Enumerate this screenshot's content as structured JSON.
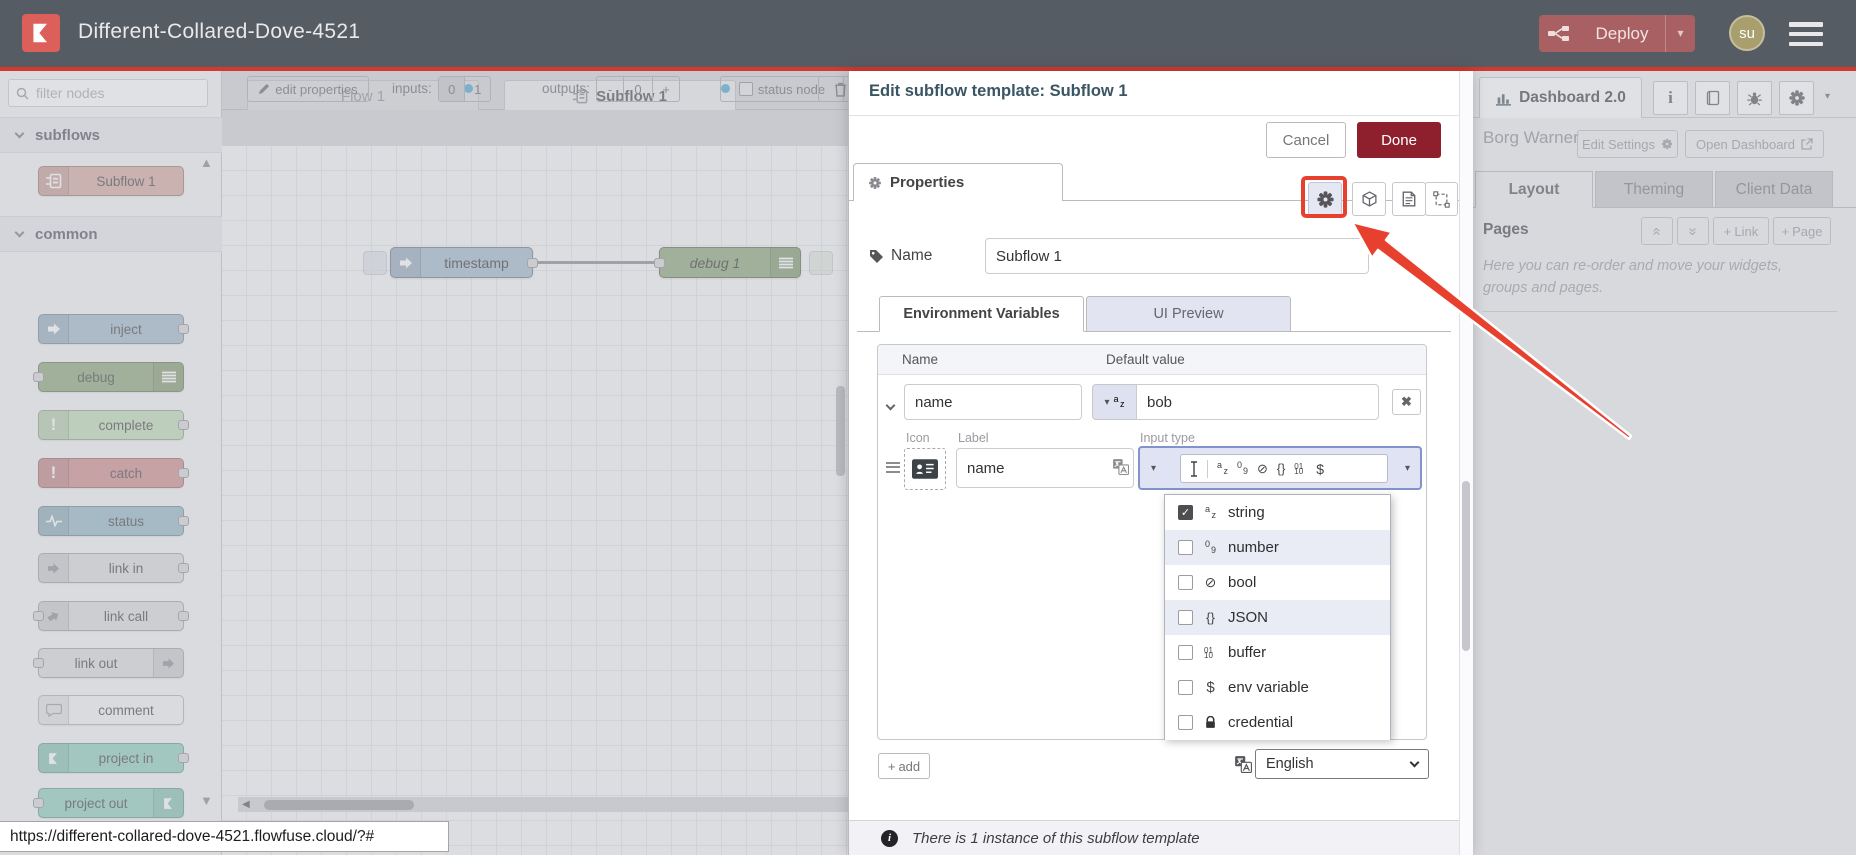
{
  "colors": {
    "header_bg": "#565c63",
    "brand_red": "#d3392e",
    "logo_red": "#dd5f5a",
    "deploy_red": "#a86063",
    "done_red": "#8e1f2d",
    "annotation_red": "#e8402f",
    "lavender": "#dfe3f3",
    "teal": "#8ed0c0",
    "modified_dot_blue": "#49a8d8"
  },
  "header": {
    "title": "Different-Collared-Dove-4521",
    "deploy_label": "Deploy",
    "avatar_initials": "su"
  },
  "palette": {
    "filter_placeholder": "filter nodes",
    "categories": [
      {
        "label": "subflows",
        "nodes": [
          {
            "label": "Subflow 1"
          }
        ]
      },
      {
        "label": "common",
        "nodes": [
          {
            "label": "inject"
          },
          {
            "label": "debug"
          },
          {
            "label": "complete"
          },
          {
            "label": "catch"
          },
          {
            "label": "status"
          },
          {
            "label": "link in"
          },
          {
            "label": "link call"
          },
          {
            "label": "link out"
          },
          {
            "label": "comment"
          },
          {
            "label": "project in"
          },
          {
            "label": "project out"
          }
        ]
      }
    ]
  },
  "workspace": {
    "tabs": [
      {
        "label": "Flow 1"
      },
      {
        "label": "Subflow 1"
      }
    ],
    "toolbar": {
      "edit_properties": "edit properties",
      "inputs_label": "inputs:",
      "input_options": [
        "0",
        "1"
      ],
      "outputs_label": "outputs:",
      "outputs_minus": "-",
      "outputs_value": "0",
      "outputs_plus": "+",
      "status_node_label": "status node"
    },
    "nodes": [
      {
        "label": "timestamp"
      },
      {
        "label": "debug 1"
      }
    ]
  },
  "dialog": {
    "title": "Edit subflow template: Subflow 1",
    "cancel_label": "Cancel",
    "done_label": "Done",
    "properties_tab": "Properties",
    "name_label": "Name",
    "name_value": "Subflow 1",
    "tabs": {
      "env": "Environment Variables",
      "ui": "UI Preview"
    },
    "table": {
      "name_col": "Name",
      "default_col": "Default value"
    },
    "row": {
      "name": "name",
      "value": "bob"
    },
    "detail": {
      "icon_label": "Icon",
      "label_label": "Label",
      "label_value": "name",
      "input_type_label": "Input type"
    },
    "type_options": [
      {
        "label": "string",
        "checked": true
      },
      {
        "label": "number",
        "checked": false
      },
      {
        "label": "bool",
        "checked": false
      },
      {
        "label": "JSON",
        "checked": false
      },
      {
        "label": "buffer",
        "checked": false
      },
      {
        "label": "env variable",
        "checked": false
      },
      {
        "label": "credential",
        "checked": false
      }
    ],
    "add_label": "add",
    "language_value": "English",
    "footer_text": "There is 1 instance of this subflow template"
  },
  "sidebar": {
    "dashboard_tab": "Dashboard 2.0",
    "project_name": "Borg Warner",
    "edit_settings_label": "Edit Settings",
    "open_dashboard_label": "Open Dashboard",
    "tabs": [
      "Layout",
      "Theming",
      "Client Data"
    ],
    "pages_label": "Pages",
    "link_button": "Link",
    "page_button": "Page",
    "help_text": "Here you can re-order and move your widgets, groups and pages."
  },
  "statusbar": {
    "url": "https://different-collared-dove-4521.flowfuse.cloud/?#"
  }
}
